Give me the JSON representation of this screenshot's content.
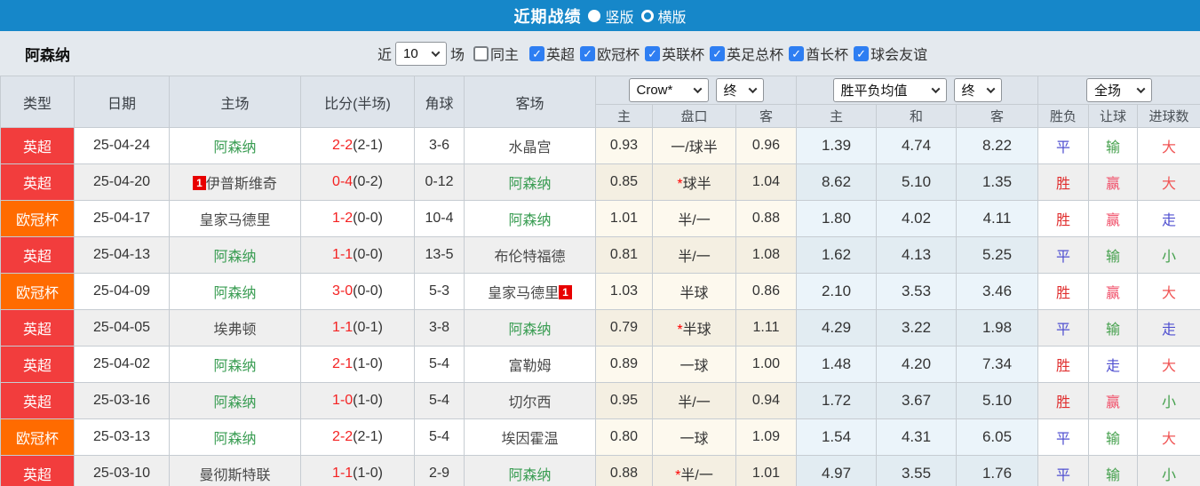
{
  "topbar": {
    "title": "近期战绩",
    "layout_options": [
      {
        "label": "竖版",
        "selected": true
      },
      {
        "label": "横版",
        "selected": false
      }
    ]
  },
  "filters": {
    "team": "阿森纳",
    "near_label": "近",
    "match_count": "10",
    "games_label": "场",
    "same_home": {
      "label": "同主",
      "checked": false
    },
    "leagues": [
      {
        "label": "英超",
        "checked": true
      },
      {
        "label": "欧冠杯",
        "checked": true
      },
      {
        "label": "英联杯",
        "checked": true
      },
      {
        "label": "英足总杯",
        "checked": true
      },
      {
        "label": "酋长杯",
        "checked": true
      },
      {
        "label": "球会友谊",
        "checked": true
      }
    ]
  },
  "table": {
    "static_headers": [
      "类型",
      "日期",
      "主场",
      "比分(半场)",
      "角球",
      "客场"
    ],
    "dropdowns": {
      "odds_company": "Crow*",
      "odds_time_1": "终",
      "europe_avg": "胜平负均值",
      "odds_time_2": "终",
      "scope": "全场"
    },
    "sub_headers": [
      "主",
      "盘口",
      "客",
      "主",
      "和",
      "客",
      "胜负",
      "让球",
      "进球数"
    ],
    "rows": [
      {
        "league": "英超",
        "league_color": "red",
        "date": "25-04-24",
        "home": {
          "name": "阿森纳",
          "self": true
        },
        "score": {
          "full": "2-2",
          "half": "(2-1)"
        },
        "corners": "3-6",
        "away": {
          "name": "水晶宫",
          "self": false
        },
        "asian": {
          "home": "0.93",
          "star": false,
          "handicap": "一/球半",
          "away": "0.96"
        },
        "europe": {
          "home": "1.39",
          "draw": "4.74",
          "away": "8.22"
        },
        "results": [
          {
            "t": "平",
            "c": "blue"
          },
          {
            "t": "输",
            "c": "green"
          },
          {
            "t": "大",
            "c": "softred"
          }
        ]
      },
      {
        "league": "英超",
        "league_color": "red",
        "date": "25-04-20",
        "home": {
          "name": "伊普斯维奇",
          "self": false,
          "red_before": "1"
        },
        "score": {
          "full": "0-4",
          "half": "(0-2)"
        },
        "corners": "0-12",
        "away": {
          "name": "阿森纳",
          "self": true
        },
        "asian": {
          "home": "0.85",
          "star": true,
          "handicap": "球半",
          "away": "1.04"
        },
        "europe": {
          "home": "8.62",
          "draw": "5.10",
          "away": "1.35"
        },
        "results": [
          {
            "t": "胜",
            "c": "red"
          },
          {
            "t": "赢",
            "c": "pink"
          },
          {
            "t": "大",
            "c": "softred"
          }
        ]
      },
      {
        "league": "欧冠杯",
        "league_color": "orange",
        "date": "25-04-17",
        "home": {
          "name": "皇家马德里",
          "self": false
        },
        "score": {
          "full": "1-2",
          "half": "(0-0)"
        },
        "corners": "10-4",
        "away": {
          "name": "阿森纳",
          "self": true
        },
        "asian": {
          "home": "1.01",
          "star": false,
          "handicap": "半/一",
          "away": "0.88"
        },
        "europe": {
          "home": "1.80",
          "draw": "4.02",
          "away": "4.11"
        },
        "results": [
          {
            "t": "胜",
            "c": "red"
          },
          {
            "t": "赢",
            "c": "pink"
          },
          {
            "t": "走",
            "c": "blue"
          }
        ]
      },
      {
        "league": "英超",
        "league_color": "red",
        "date": "25-04-13",
        "home": {
          "name": "阿森纳",
          "self": true
        },
        "score": {
          "full": "1-1",
          "half": "(0-0)"
        },
        "corners": "13-5",
        "away": {
          "name": "布伦特福德",
          "self": false
        },
        "asian": {
          "home": "0.81",
          "star": false,
          "handicap": "半/一",
          "away": "1.08"
        },
        "europe": {
          "home": "1.62",
          "draw": "4.13",
          "away": "5.25"
        },
        "results": [
          {
            "t": "平",
            "c": "blue"
          },
          {
            "t": "输",
            "c": "green"
          },
          {
            "t": "小",
            "c": "green"
          }
        ]
      },
      {
        "league": "欧冠杯",
        "league_color": "orange",
        "date": "25-04-09",
        "home": {
          "name": "阿森纳",
          "self": true
        },
        "score": {
          "full": "3-0",
          "half": "(0-0)"
        },
        "corners": "5-3",
        "away": {
          "name": "皇家马德里",
          "self": false,
          "red_after": "1"
        },
        "asian": {
          "home": "1.03",
          "star": false,
          "handicap": "半球",
          "away": "0.86"
        },
        "europe": {
          "home": "2.10",
          "draw": "3.53",
          "away": "3.46"
        },
        "results": [
          {
            "t": "胜",
            "c": "red"
          },
          {
            "t": "赢",
            "c": "pink"
          },
          {
            "t": "大",
            "c": "softred"
          }
        ]
      },
      {
        "league": "英超",
        "league_color": "red",
        "date": "25-04-05",
        "home": {
          "name": "埃弗顿",
          "self": false
        },
        "score": {
          "full": "1-1",
          "half": "(0-1)"
        },
        "corners": "3-8",
        "away": {
          "name": "阿森纳",
          "self": true
        },
        "asian": {
          "home": "0.79",
          "star": true,
          "handicap": "半球",
          "away": "1.11"
        },
        "europe": {
          "home": "4.29",
          "draw": "3.22",
          "away": "1.98"
        },
        "results": [
          {
            "t": "平",
            "c": "blue"
          },
          {
            "t": "输",
            "c": "green"
          },
          {
            "t": "走",
            "c": "blue"
          }
        ]
      },
      {
        "league": "英超",
        "league_color": "red",
        "date": "25-04-02",
        "home": {
          "name": "阿森纳",
          "self": true
        },
        "score": {
          "full": "2-1",
          "half": "(1-0)"
        },
        "corners": "5-4",
        "away": {
          "name": "富勒姆",
          "self": false
        },
        "asian": {
          "home": "0.89",
          "star": false,
          "handicap": "一球",
          "away": "1.00"
        },
        "europe": {
          "home": "1.48",
          "draw": "4.20",
          "away": "7.34"
        },
        "results": [
          {
            "t": "胜",
            "c": "red"
          },
          {
            "t": "走",
            "c": "blue"
          },
          {
            "t": "大",
            "c": "softred"
          }
        ]
      },
      {
        "league": "英超",
        "league_color": "red",
        "date": "25-03-16",
        "home": {
          "name": "阿森纳",
          "self": true
        },
        "score": {
          "full": "1-0",
          "half": "(1-0)"
        },
        "corners": "5-4",
        "away": {
          "name": "切尔西",
          "self": false
        },
        "asian": {
          "home": "0.95",
          "star": false,
          "handicap": "半/一",
          "away": "0.94"
        },
        "europe": {
          "home": "1.72",
          "draw": "3.67",
          "away": "5.10"
        },
        "results": [
          {
            "t": "胜",
            "c": "red"
          },
          {
            "t": "赢",
            "c": "pink"
          },
          {
            "t": "小",
            "c": "green"
          }
        ]
      },
      {
        "league": "欧冠杯",
        "league_color": "orange",
        "date": "25-03-13",
        "home": {
          "name": "阿森纳",
          "self": true
        },
        "score": {
          "full": "2-2",
          "half": "(2-1)"
        },
        "corners": "5-4",
        "away": {
          "name": "埃因霍温",
          "self": false
        },
        "asian": {
          "home": "0.80",
          "star": false,
          "handicap": "一球",
          "away": "1.09"
        },
        "europe": {
          "home": "1.54",
          "draw": "4.31",
          "away": "6.05"
        },
        "results": [
          {
            "t": "平",
            "c": "blue"
          },
          {
            "t": "输",
            "c": "green"
          },
          {
            "t": "大",
            "c": "softred"
          }
        ]
      },
      {
        "league": "英超",
        "league_color": "red",
        "date": "25-03-10",
        "home": {
          "name": "曼彻斯特联",
          "self": false
        },
        "score": {
          "full": "1-1",
          "half": "(1-0)"
        },
        "corners": "2-9",
        "away": {
          "name": "阿森纳",
          "self": true
        },
        "asian": {
          "home": "0.88",
          "star": true,
          "handicap": "半/一",
          "away": "1.01"
        },
        "europe": {
          "home": "4.97",
          "draw": "3.55",
          "away": "1.76"
        },
        "results": [
          {
            "t": "平",
            "c": "blue"
          },
          {
            "t": "输",
            "c": "green"
          },
          {
            "t": "小",
            "c": "green"
          }
        ]
      }
    ]
  },
  "colors": {
    "accent": "#1687c9",
    "league_red": "#f23d3d",
    "league_orange": "#ff6b00",
    "self_team_green": "#3a9d53",
    "score_red": "#f42222",
    "result_red": "#e02e2e",
    "result_pink": "#f0506a",
    "result_green": "#44a04c",
    "result_blue": "#5050d0",
    "result_soft_red": "#f05555",
    "checkbox_blue": "#2e7ef2"
  }
}
